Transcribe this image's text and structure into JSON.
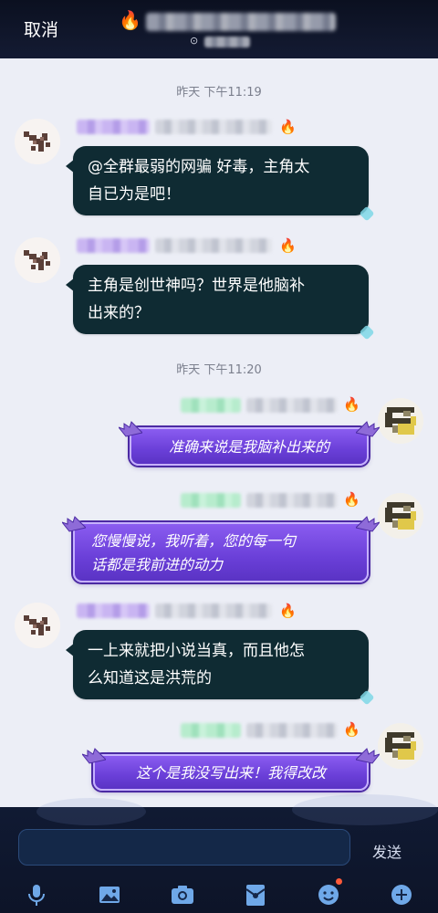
{
  "header": {
    "cancel_label": "取消"
  },
  "chat": {
    "timestamps": [
      "昨天 下午11:19",
      "昨天 下午11:20"
    ],
    "messages": [
      {
        "side": "in",
        "text_lines": [
          "@全群最弱的网骗 好毒，主角太",
          "自已为是吧！"
        ]
      },
      {
        "side": "in",
        "text_lines": [
          "主角是创世神吗？世界是他脑补",
          "出来的？"
        ]
      },
      {
        "side": "out",
        "text_lines": [
          "准确来说是我脑补出来的"
        ]
      },
      {
        "side": "out",
        "text_lines": [
          "您慢慢说，我听着，您的每一句",
          "话都是我前进的动力"
        ]
      },
      {
        "side": "in",
        "text_lines": [
          "一上来就把小说当真，而且他怎",
          "么知道这是洪荒的"
        ]
      },
      {
        "side": "out",
        "text_lines": [
          "这个是我没写出来！我得改改"
        ]
      }
    ]
  },
  "input": {
    "value": "",
    "send_label": "发送"
  },
  "toolbar": {
    "icons": [
      "microphone-icon",
      "image-icon",
      "camera-icon",
      "red-packet-icon",
      "emoji-icon",
      "plus-icon"
    ]
  },
  "colors": {
    "header_bg": "#0b1020",
    "chat_bg": "#eceef6",
    "incoming_bubble": "#0f2b33",
    "outgoing_bubble": "#6a3fd8",
    "timestamp": "#7b7f8d"
  }
}
